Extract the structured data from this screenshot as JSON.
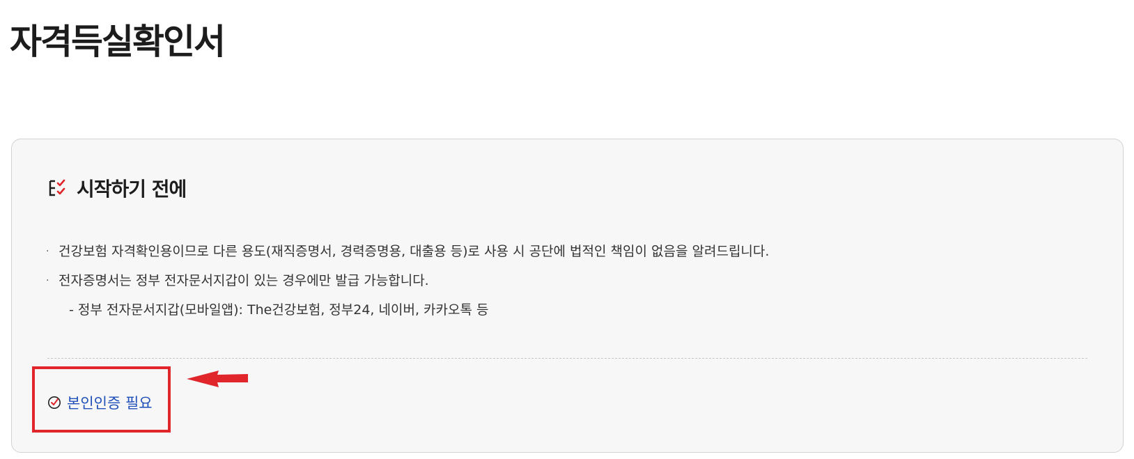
{
  "page": {
    "title": "자격득실확인서"
  },
  "notice_box": {
    "heading": "시작하기 전에",
    "heading_icon": "checklist-icon",
    "items": [
      {
        "bullet": "·",
        "text": "건강보험 자격확인용이므로 다른 용도(재직증명서, 경력증명용, 대출용 등)로 사용 시 공단에 법적인 책임이 없음을 알려드립니다."
      },
      {
        "bullet": "·",
        "text": "전자증명서는 정부 전자문서지갑이 있는 경우에만 발급 가능합니다."
      },
      {
        "bullet": "",
        "text": "- 정부 전자문서지갑(모바일앱): The건강보험, 정부24, 네이버, 카카오톡 등"
      }
    ]
  },
  "auth": {
    "label": "본인인증 필요",
    "icon": "check-circle-icon"
  },
  "colors": {
    "annotation_red": "#e0252b",
    "link_blue": "#1f4fb8",
    "box_background": "#f7f7f7"
  }
}
